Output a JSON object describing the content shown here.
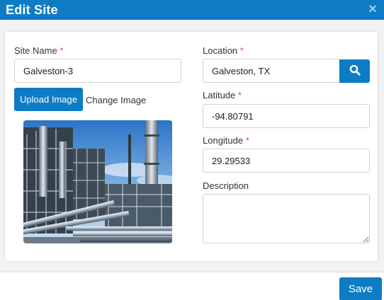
{
  "dialog": {
    "title": "Edit Site",
    "close_glyph": "×"
  },
  "form": {
    "site_name": {
      "label": "Site Name",
      "required_mark": "*",
      "value": "Galveston-3"
    },
    "upload_label": "Upload Image",
    "change_label": "Change Image",
    "location": {
      "label": "Location",
      "required_mark": "*",
      "value": "Galveston, TX"
    },
    "latitude": {
      "label": "Latitude",
      "required_mark": "*",
      "value": "-94.80791"
    },
    "longitude": {
      "label": "Longitude",
      "required_mark": "*",
      "value": "29.29533"
    },
    "description": {
      "label": "Description",
      "value": ""
    }
  },
  "footer": {
    "save_label": "Save"
  },
  "icons": {
    "close": "close-icon",
    "search": "search-icon",
    "site_image": "refinery-photo"
  },
  "colors": {
    "accent": "#0d7cc5",
    "required": "#d9534f"
  }
}
